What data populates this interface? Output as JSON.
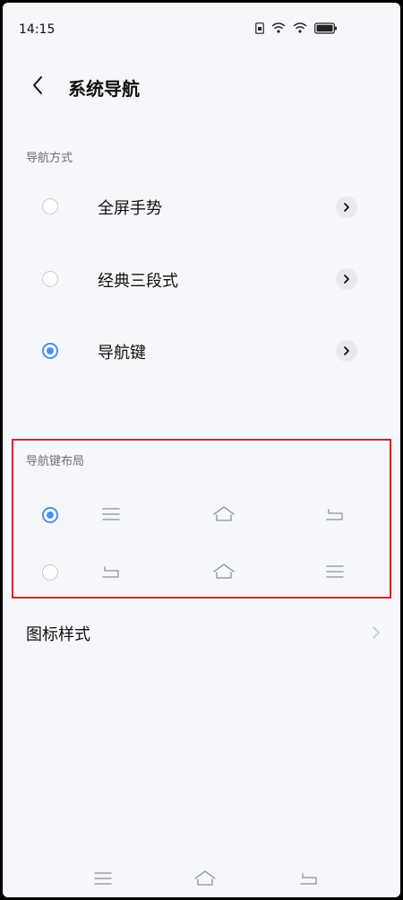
{
  "status_bar": {
    "time": "14:15"
  },
  "header": {
    "title": "系统导航"
  },
  "nav_method": {
    "section_label": "导航方式",
    "options": [
      {
        "label": "全屏手势",
        "selected": false
      },
      {
        "label": "经典三段式",
        "selected": false
      },
      {
        "label": "导航键",
        "selected": true
      }
    ]
  },
  "nav_layout": {
    "section_label": "导航键布局",
    "layouts": [
      {
        "selected": true,
        "icons": [
          "menu-icon",
          "home-icon",
          "back-icon"
        ]
      },
      {
        "selected": false,
        "icons": [
          "back-icon",
          "home-icon",
          "menu-icon"
        ]
      }
    ]
  },
  "icon_style": {
    "label": "图标样式"
  },
  "bottom_nav": {
    "icons": [
      "menu-icon",
      "home-icon",
      "back-icon"
    ]
  },
  "colors": {
    "accent": "#4c8ff0",
    "highlight_border": "#d4232f"
  }
}
